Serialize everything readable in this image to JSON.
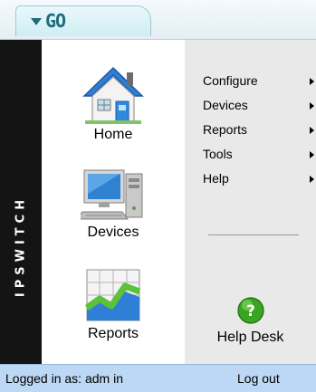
{
  "header": {
    "go_label": "GO"
  },
  "brand": {
    "name": "IPSWITCH"
  },
  "nav": {
    "items": [
      {
        "label": "Home",
        "icon": "home-icon"
      },
      {
        "label": "Devices",
        "icon": "computer-icon"
      },
      {
        "label": "Reports",
        "icon": "chart-icon"
      }
    ]
  },
  "menu": {
    "items": [
      {
        "label": "Configure"
      },
      {
        "label": "Devices"
      },
      {
        "label": "Reports"
      },
      {
        "label": "Tools"
      },
      {
        "label": "Help"
      }
    ],
    "helpdesk_label": "Help Desk",
    "helpdesk_icon": "help-icon"
  },
  "status": {
    "logged_in_text": "Logged in as: adm in",
    "logout_label": "Log out"
  },
  "colors": {
    "brand_strip": "#141414",
    "status_bar": "#bcd8f4",
    "go_text": "#1f6d7a"
  }
}
